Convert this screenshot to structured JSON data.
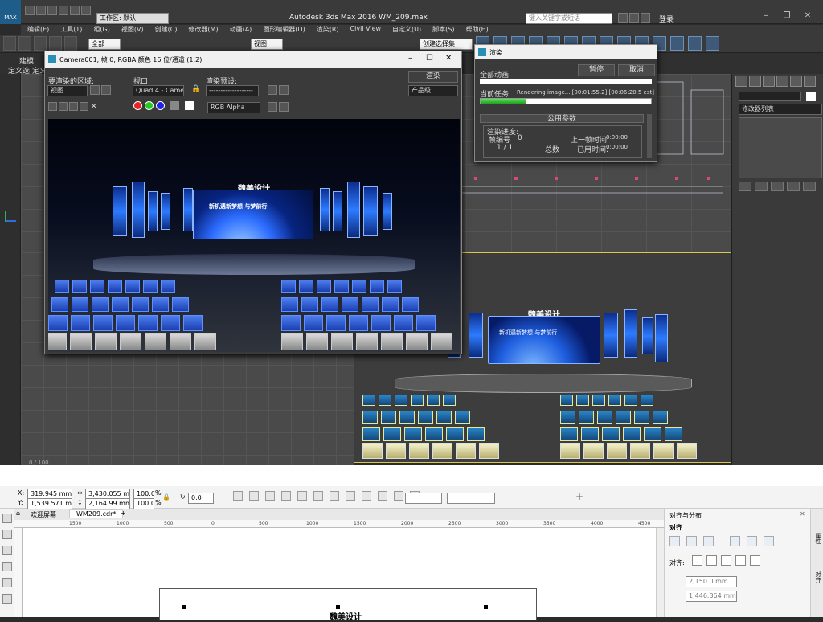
{
  "max": {
    "logo": "MAX",
    "workspace_label": "工作区: 默认",
    "title": "Autodesk 3ds Max 2016    WM_209.max",
    "search_placeholder": "键入关键字或短语",
    "login": "登录",
    "menu": [
      "编辑(E)",
      "工具(T)",
      "组(G)",
      "视图(V)",
      "创建(C)",
      "修改器(M)",
      "动画(A)",
      "图形编辑器(D)",
      "渲染(R)",
      "Civil View",
      "自定义(U)",
      "脚本(S)",
      "帮助(H)"
    ],
    "toolbar": {
      "filter": "全部",
      "view": "视图",
      "selset": "创建选择集"
    },
    "left_tabs": [
      "建模",
      "定义选",
      "定义选"
    ],
    "timeline": "0 / 100"
  },
  "frame": {
    "title": "Camera001, 帧 0, RGBA 颜色 16 位/通道 (1:2)",
    "area_label": "要渲染的区域:",
    "area_value": "视图",
    "viewport_label": "视口:",
    "viewport_value": "Quad 4 - Camera(",
    "preset_label": "渲染预设:",
    "preset_value": "-------------------",
    "render_btn": "渲染",
    "product_value": "产品级",
    "channel_value": "RGB Alpha",
    "stage_title": "魏美设计",
    "screen_text": "新机遇新梦想  与梦前行"
  },
  "progress": {
    "title": "渲染",
    "all_label": "全部动画:",
    "pause": "暂停",
    "cancel": "取消",
    "current_label": "当前任务:",
    "current_value": "Rendering image... [00:01:55.2] [00:06:20.5 est]",
    "progress_fraction": 0.27,
    "params_header": "公用参数",
    "render_progress": "渲染进度:",
    "frame_no_label": "帧编号",
    "frame_no": "0",
    "frame_of": "1 / 1",
    "total": "总数",
    "last_time_label": "上一帧时间:",
    "last_time": "0:00:00",
    "elapsed_label": "已用时间:",
    "elapsed": "0:00:00"
  },
  "cmd": {
    "modifier_list": "修改器列表"
  },
  "viewport": {
    "stage_title": "魏美设计",
    "screen_text": "新机遇新梦想  与梦前行"
  },
  "corel": {
    "x_label": "X:",
    "x_value": "319.945 mm",
    "y_label": "Y:",
    "y_value": "1,539.571 mm",
    "w_value": "3,430.055 mm",
    "h_value": "2,164.99 mm",
    "sx": "100.0",
    "sy": "100.0",
    "pct": "%",
    "angle": "0.0",
    "tab1": "欢迎屏幕",
    "tab2": "WM209.cdr*",
    "tab_add": "+",
    "ruler": [
      "1500",
      "1000",
      "500",
      "0",
      "500",
      "1000",
      "1500",
      "2000",
      "2500",
      "3000",
      "3500",
      "4000",
      "4500"
    ],
    "docker_title": "对齐与分布",
    "align_label": "对齐",
    "align_to": "对齐:",
    "dx": "2,150.0 mm",
    "dy": "1,446.364 mm",
    "side_tabs": [
      "属性",
      "对齐"
    ],
    "doc_title": "魏美设计"
  }
}
